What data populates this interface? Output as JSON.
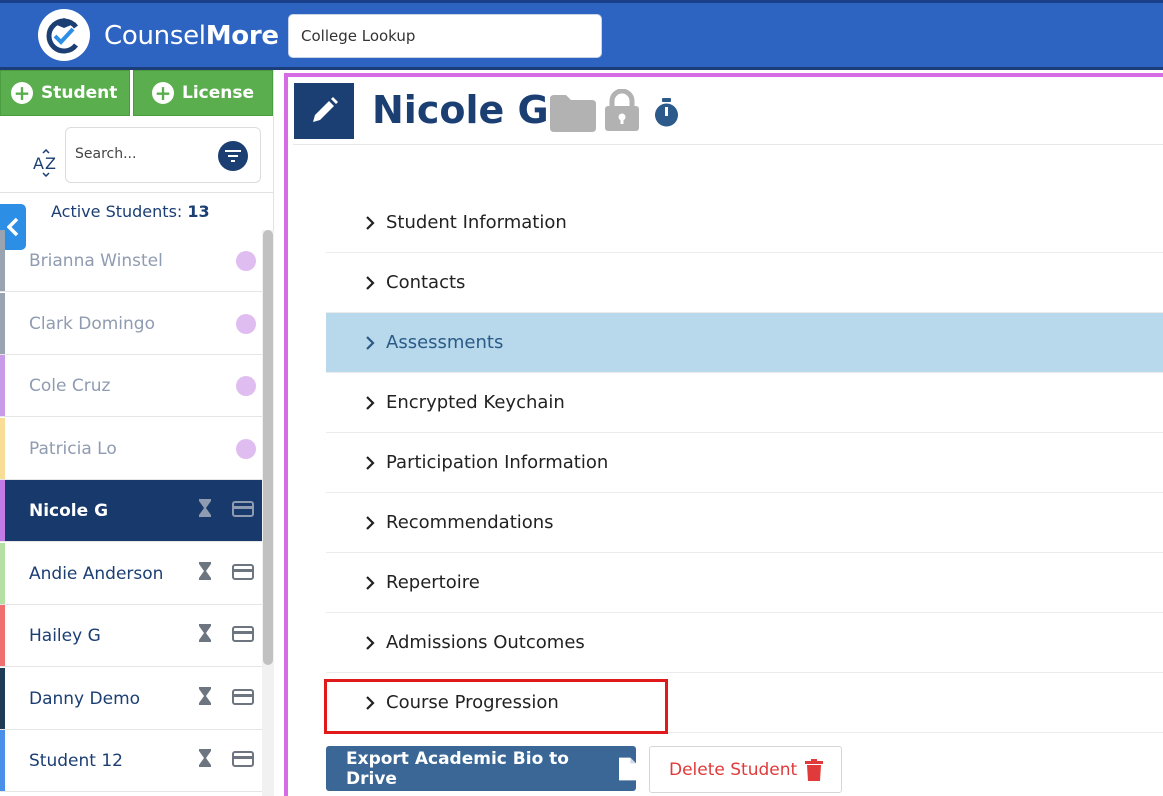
{
  "header": {
    "brand_light": "Counsel",
    "brand_bold": "More",
    "college_lookup_value": "College Lookup"
  },
  "sidebar": {
    "add_student_label": "Student",
    "add_license_label": "License",
    "search_placeholder": "Search...",
    "active_label": "Active Students:",
    "active_count": "13",
    "students": [
      {
        "name": "Brianna Winstel",
        "status": "inactive",
        "color": "#9aa4b1"
      },
      {
        "name": "Clark Domingo",
        "status": "inactive",
        "color": "#9aa4b1"
      },
      {
        "name": "Cole Cruz",
        "status": "inactive",
        "color": "#c89be8"
      },
      {
        "name": "Patricia Lo",
        "status": "inactive",
        "color": "#f8dd96"
      },
      {
        "name": "Nicole G",
        "status": "selected",
        "color": "#c07be5"
      },
      {
        "name": "Andie Anderson",
        "status": "active",
        "color": "#b4e0a4"
      },
      {
        "name": "Hailey G",
        "status": "active",
        "color": "#f07070"
      },
      {
        "name": "Danny Demo",
        "status": "active",
        "color": "#1f3a55"
      },
      {
        "name": "Student 12",
        "status": "active",
        "color": "#4a90e8"
      }
    ]
  },
  "main": {
    "student_name": "Nicole G",
    "sections": [
      "Student Information",
      "Contacts",
      "Assessments",
      "Encrypted Keychain",
      "Participation Information",
      "Recommendations",
      "Repertoire",
      "Admissions Outcomes",
      "Course Progression"
    ],
    "highlighted_section": "Assessments",
    "export_label": "Export Academic Bio to Drive",
    "delete_label": "Delete Student"
  },
  "colors": {
    "header_blue": "#2d64c2",
    "navy": "#1b3e73",
    "green": "#5aae4e",
    "highlight": "#b8d8ec",
    "danger": "#e03a3a",
    "focus_border": "#d56ce3"
  }
}
